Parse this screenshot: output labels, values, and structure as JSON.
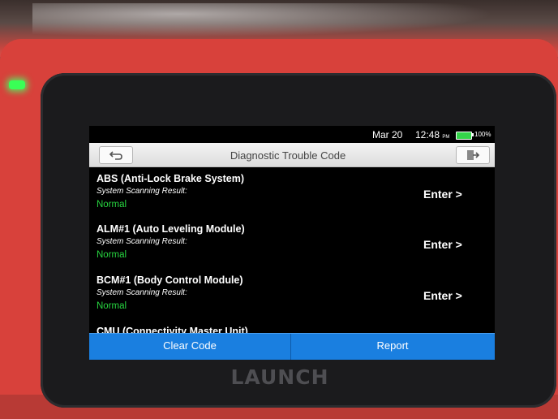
{
  "status": {
    "date": "Mar 20",
    "time": "12:48",
    "ampm": "PM",
    "battery": "100%",
    "battery_level": 1.0
  },
  "header": {
    "title": "Diagnostic Trouble Code"
  },
  "systems": [
    {
      "name": "ABS (Anti-Lock Brake System)",
      "result_label": "System Scanning Result:",
      "result": "Normal",
      "action": "Enter >"
    },
    {
      "name": "ALM#1 (Auto Leveling Module)",
      "result_label": "System Scanning Result:",
      "result": "Normal",
      "action": "Enter >"
    },
    {
      "name": "BCM#1 (Body Control Module)",
      "result_label": "System Scanning Result:",
      "result": "Normal",
      "action": "Enter >"
    },
    {
      "name": "CMU (Connectivity Master Unit)"
    }
  ],
  "footer": {
    "clear_label": "Clear Code",
    "report_label": "Report"
  },
  "device": {
    "brand": "LAUNCH"
  },
  "colors": {
    "accent": "#1a7fe0",
    "status_normal": "#27d640",
    "device_body": "#d8413b"
  }
}
